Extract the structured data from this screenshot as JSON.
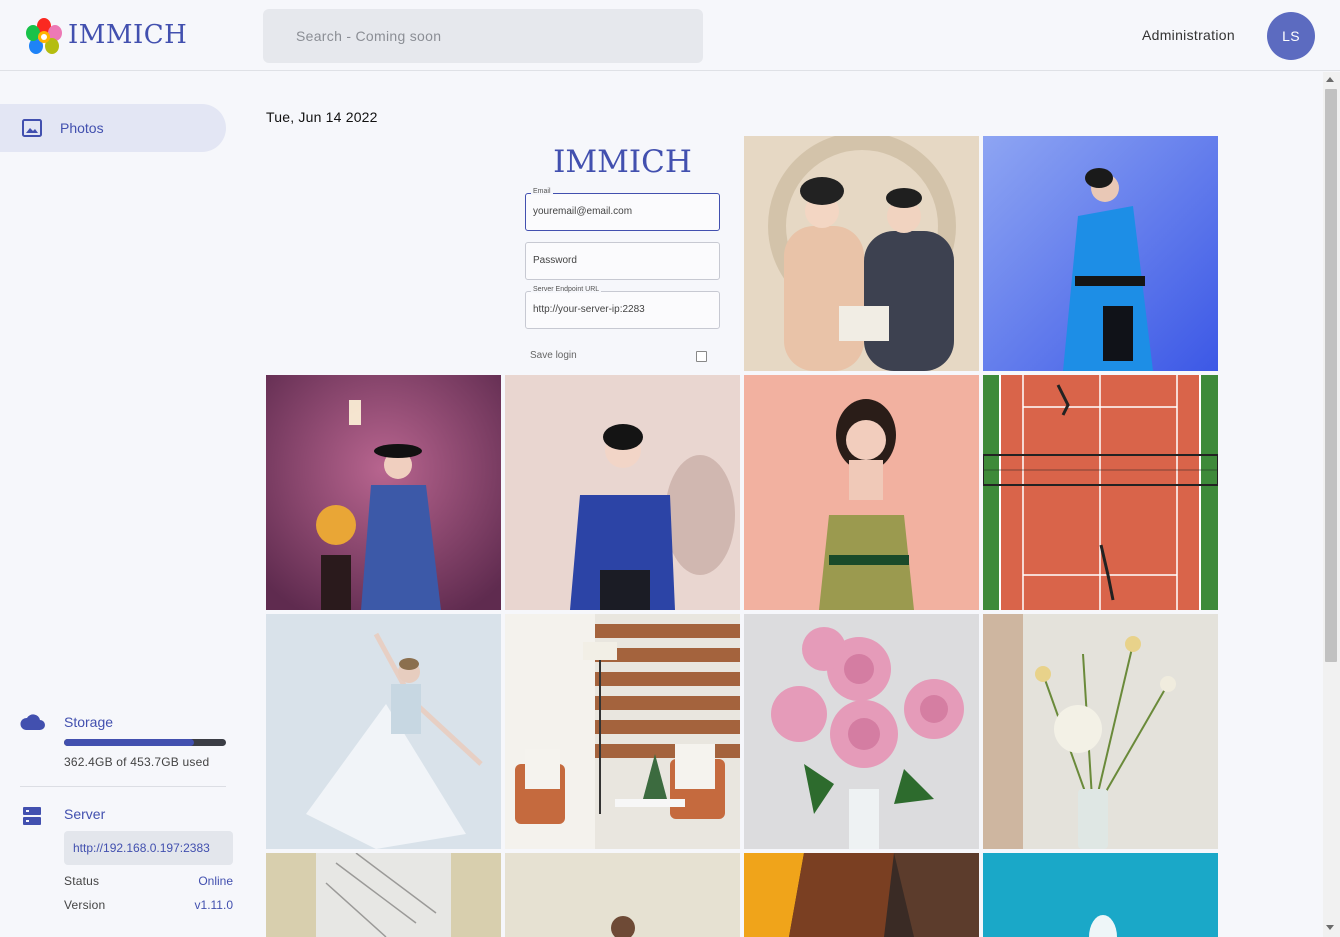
{
  "header": {
    "brand": "IMMICH",
    "search_placeholder": "Search - Coming soon",
    "admin_label": "Administration",
    "avatar_initials": "LS",
    "logo_icon": "immich-flower-logo"
  },
  "sidebar": {
    "nav": [
      {
        "label": "Photos",
        "icon": "image-icon",
        "active": true
      }
    ],
    "storage": {
      "title": "Storage",
      "used_text": "362.4GB of 453.7GB used",
      "used_fraction": 0.8,
      "icon": "cloud-icon"
    },
    "server": {
      "title": "Server",
      "url": "http://192.168.0.197:2383",
      "status_label": "Status",
      "status_value": "Online",
      "version_label": "Version",
      "version_value": "v1.11.0",
      "icon": "server-icon"
    }
  },
  "main": {
    "date_heading": "Tue, Jun 14 2022",
    "login_preview": {
      "brand": "IMMICH",
      "email_label": "Email",
      "email_value": "youremail@email.com",
      "password_placeholder": "Password",
      "endpoint_label": "Server Endpoint URL",
      "endpoint_value": "http://your-server-ip:2283",
      "save_login": "Save login"
    }
  },
  "colors": {
    "accent": "#4250af",
    "avatar_bg": "#5c6bc0",
    "page_bg": "#f6f7fb"
  }
}
